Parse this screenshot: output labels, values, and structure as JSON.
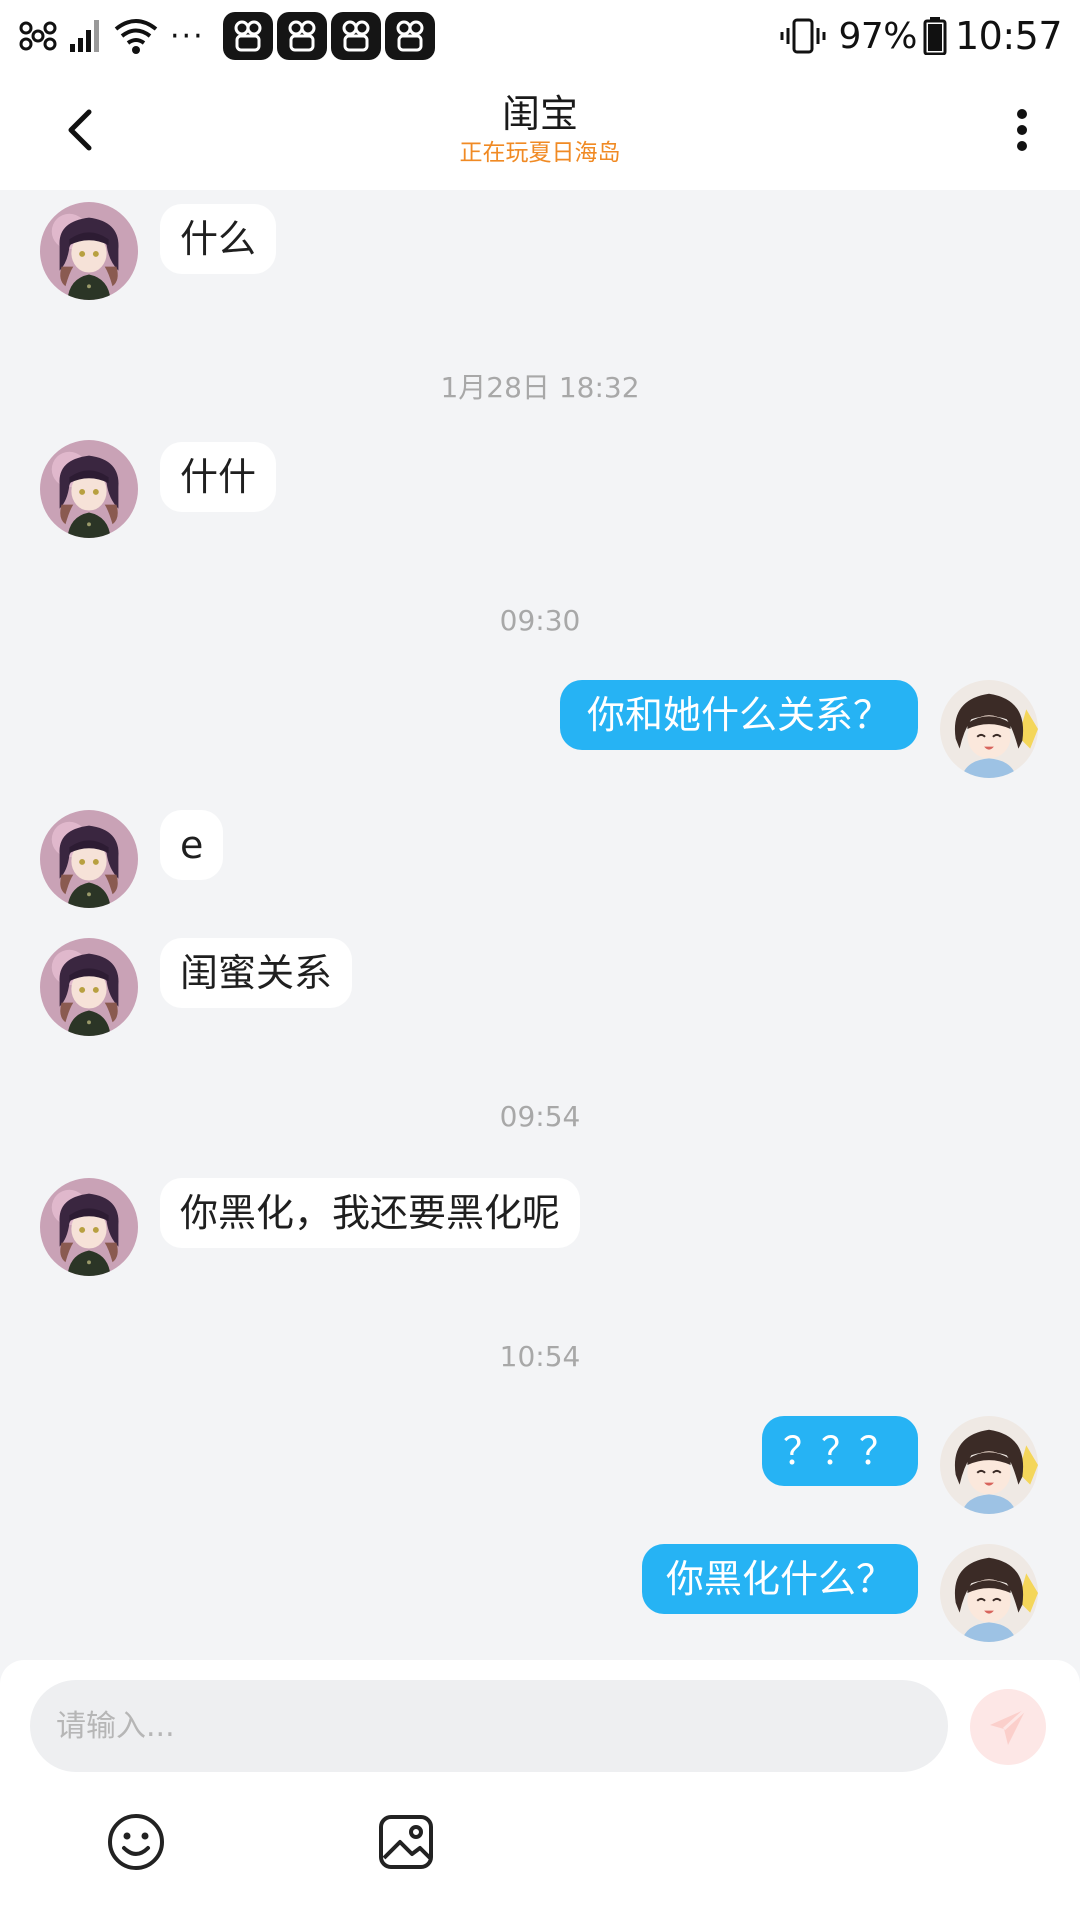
{
  "status_bar": {
    "battery": "97%",
    "time": "10:57",
    "more": "···",
    "icons": [
      "signal-weak-icon",
      "cell-signal-icon",
      "wifi-icon",
      "app-notification-icon",
      "vibrate-icon",
      "battery-icon"
    ]
  },
  "header": {
    "title": "闺宝",
    "subtitle": "正在玩夏日海岛",
    "accent_color": "#f08a24"
  },
  "timestamps": {
    "t1": "1月28日 18:32",
    "t2": "09:30",
    "t3": "09:54",
    "t4": "10:54"
  },
  "messages": [
    {
      "from": "them",
      "text": "什么"
    },
    {
      "from": "them",
      "text": "什什"
    },
    {
      "from": "me",
      "text": "你和她什么关系？"
    },
    {
      "from": "them",
      "text": "e"
    },
    {
      "from": "them",
      "text": "闺蜜关系"
    },
    {
      "from": "them",
      "text": "你黑化，我还要黑化呢"
    },
    {
      "from": "me",
      "text": "？？？"
    },
    {
      "from": "me",
      "text": "你黑化什么？"
    }
  ],
  "colors": {
    "my_bubble": "#26b3f4",
    "their_bubble": "#ffffff",
    "background": "#f3f4f6"
  },
  "composer": {
    "placeholder": "请输入...",
    "value": "",
    "send_icon": "send-icon",
    "emoji_icon": "emoji-icon",
    "image_icon": "image-icon"
  }
}
